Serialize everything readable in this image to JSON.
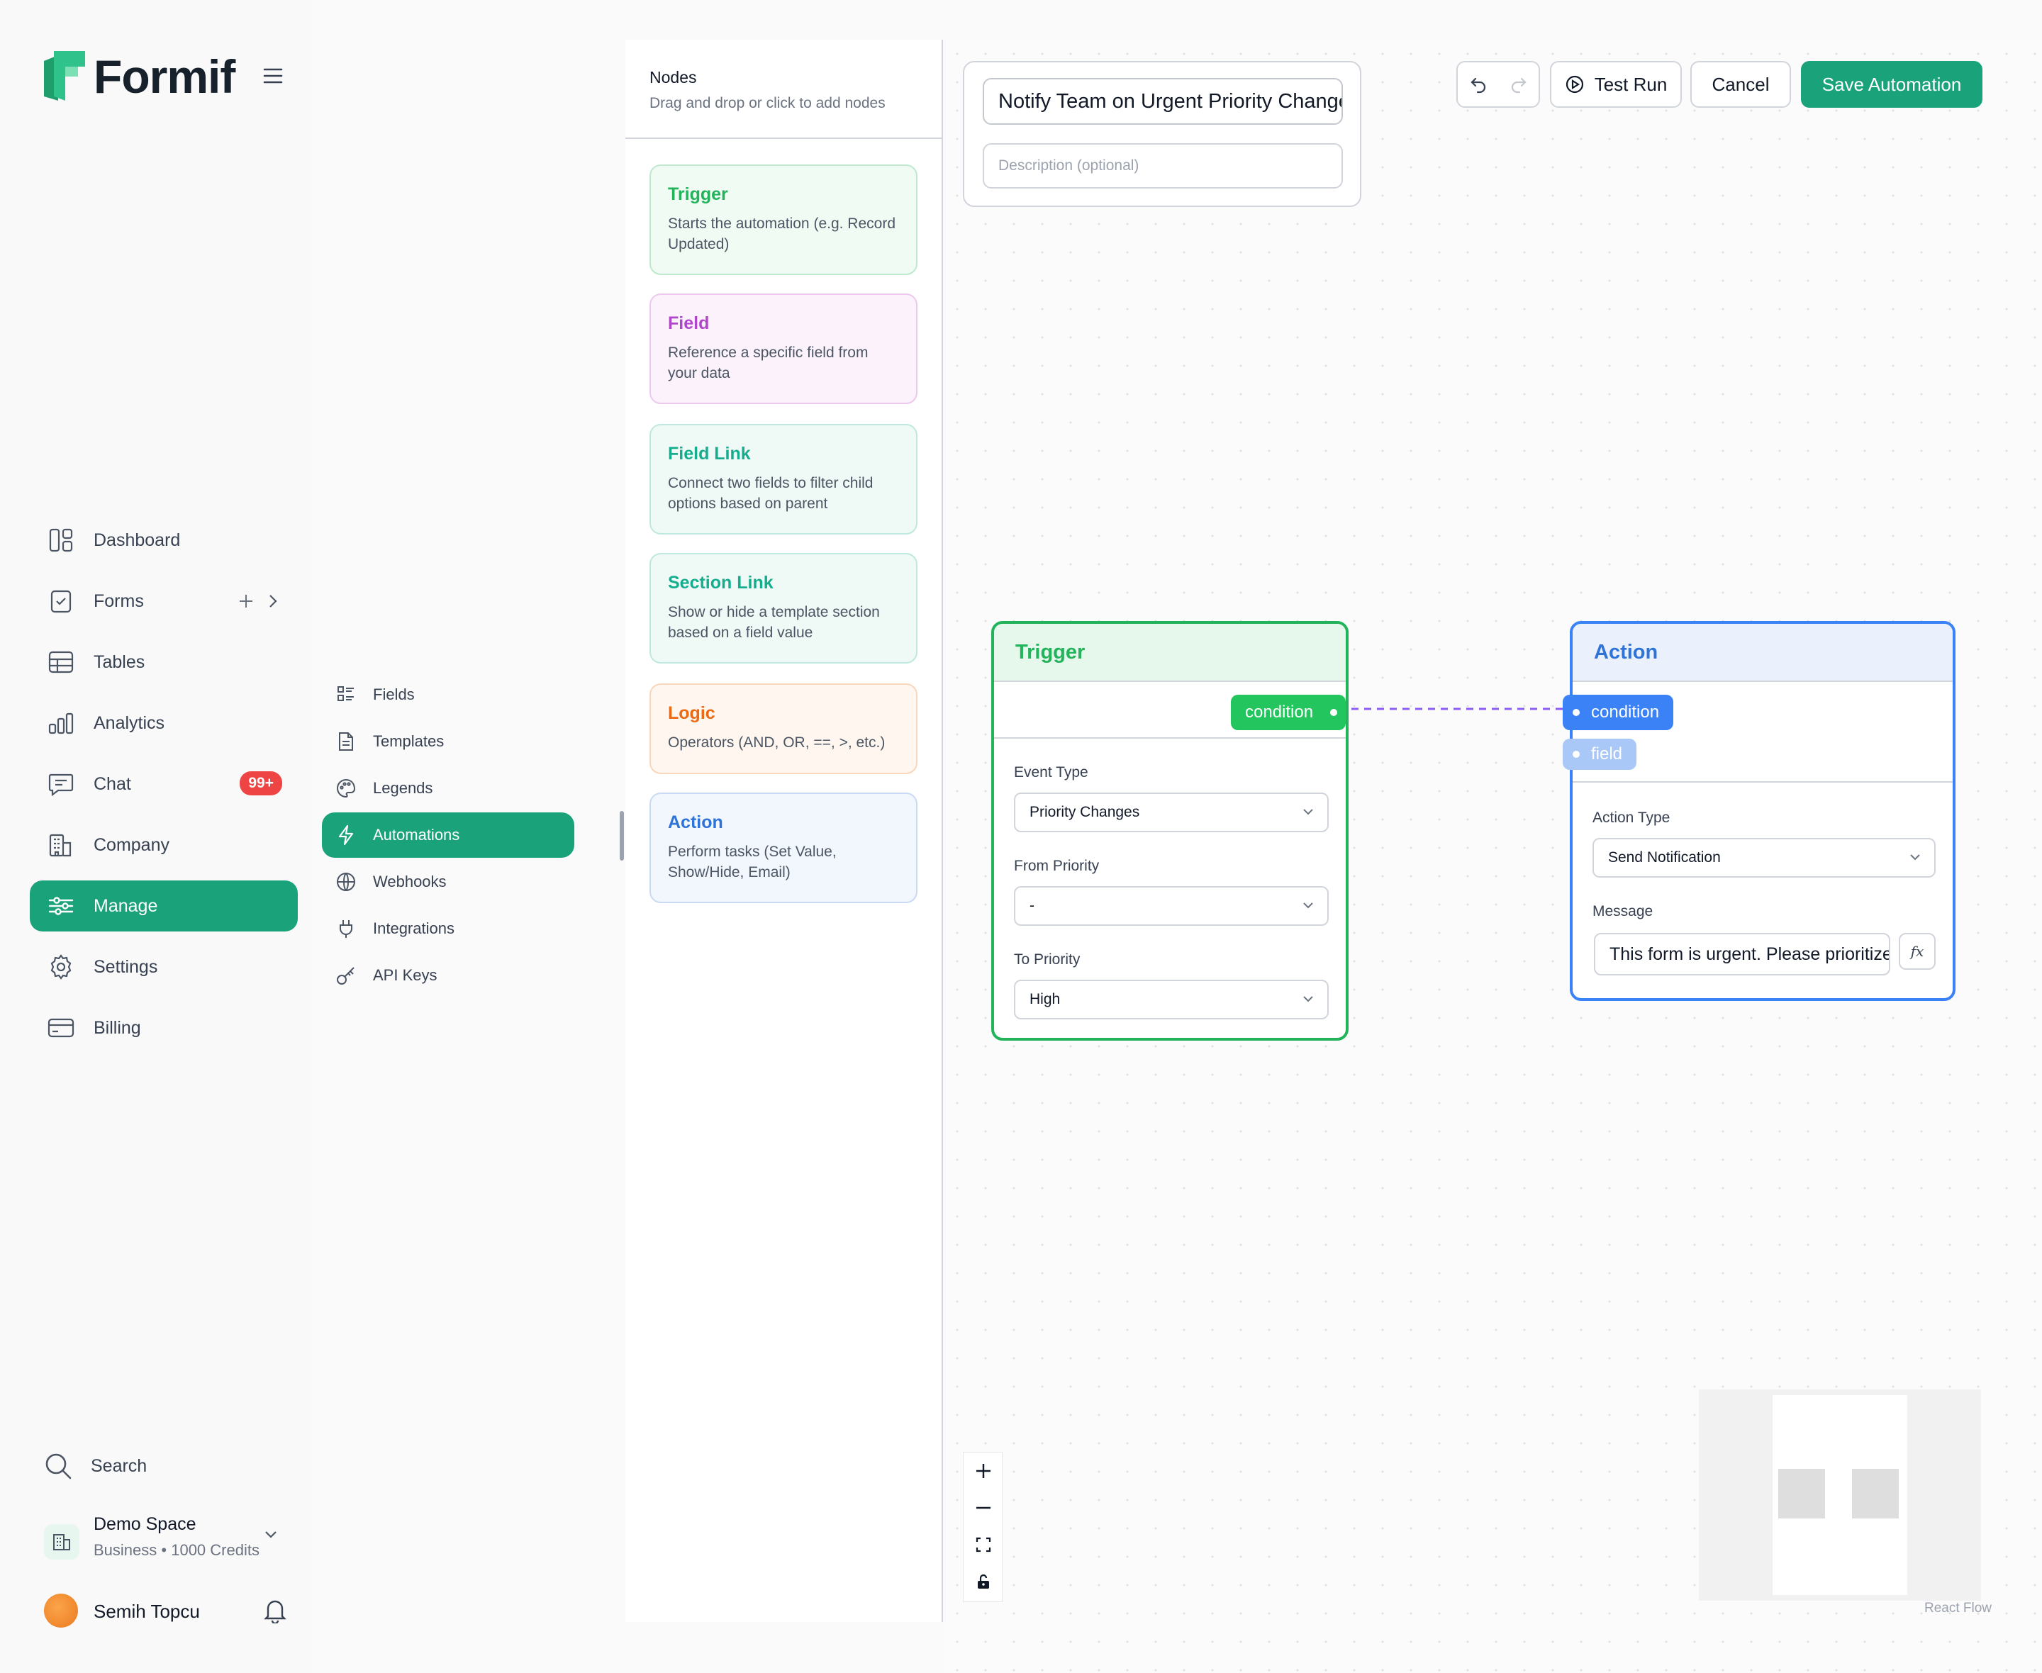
{
  "brand": {
    "name": "Formif"
  },
  "nav": {
    "dashboard": "Dashboard",
    "forms": "Forms",
    "tables": "Tables",
    "analytics": "Analytics",
    "chat": "Chat",
    "chat_badge": "99+",
    "company": "Company",
    "manage": "Manage",
    "settings": "Settings",
    "billing": "Billing"
  },
  "subnav": {
    "fields": "Fields",
    "templates": "Templates",
    "legends": "Legends",
    "automations": "Automations",
    "webhooks": "Webhooks",
    "integrations": "Integrations",
    "api_keys": "API Keys"
  },
  "footer": {
    "search": "Search",
    "space_name": "Demo Space",
    "space_plan": "Business",
    "space_credits": "1000 Credits",
    "user_name": "Semih Topcu"
  },
  "nodes_panel": {
    "title": "Nodes",
    "subtitle": "Drag and drop or click to add nodes",
    "cards": [
      {
        "title": "Trigger",
        "desc": "Starts the automation (e.g. Record Updated)",
        "color": "#22b35b"
      },
      {
        "title": "Field",
        "desc": "Reference a specific field from your data",
        "color": "#b046c9"
      },
      {
        "title": "Field Link",
        "desc": "Connect two fields to filter child options based on parent",
        "color": "#16ad8f"
      },
      {
        "title": "Section Link",
        "desc": "Show or hide a template section based on a field value",
        "color": "#16ad8f"
      },
      {
        "title": "Logic",
        "desc": "Operators (AND, OR, ==, >, etc.)",
        "color": "#ea6a14"
      },
      {
        "title": "Action",
        "desc": "Perform tasks (Set Value, Show/Hide, Email)",
        "color": "#2f73d8"
      }
    ]
  },
  "automation": {
    "name": "Notify Team on Urgent Priority Change",
    "description_placeholder": "Description (optional)"
  },
  "toolbar": {
    "test_run": "Test Run",
    "cancel": "Cancel",
    "save": "Save Automation"
  },
  "trigger_node": {
    "title": "Trigger",
    "output_handle": "condition ✓",
    "event_type_label": "Event Type",
    "event_type_value": "Priority Changes",
    "from_label": "From Priority",
    "from_value": "-",
    "to_label": "To Priority",
    "to_value": "High"
  },
  "action_node": {
    "title": "Action",
    "input_condition": "condition",
    "input_field": "field",
    "action_type_label": "Action Type",
    "action_type_value": "Send Notification",
    "message_label": "Message",
    "message_value": "This form is urgent. Please prioritize."
  },
  "canvas": {
    "attribution": "React Flow"
  },
  "colors": {
    "primary": "#1aa37a",
    "trigger": "#22b35b",
    "action": "#2f73d8",
    "edge": "#8b5cf6"
  }
}
